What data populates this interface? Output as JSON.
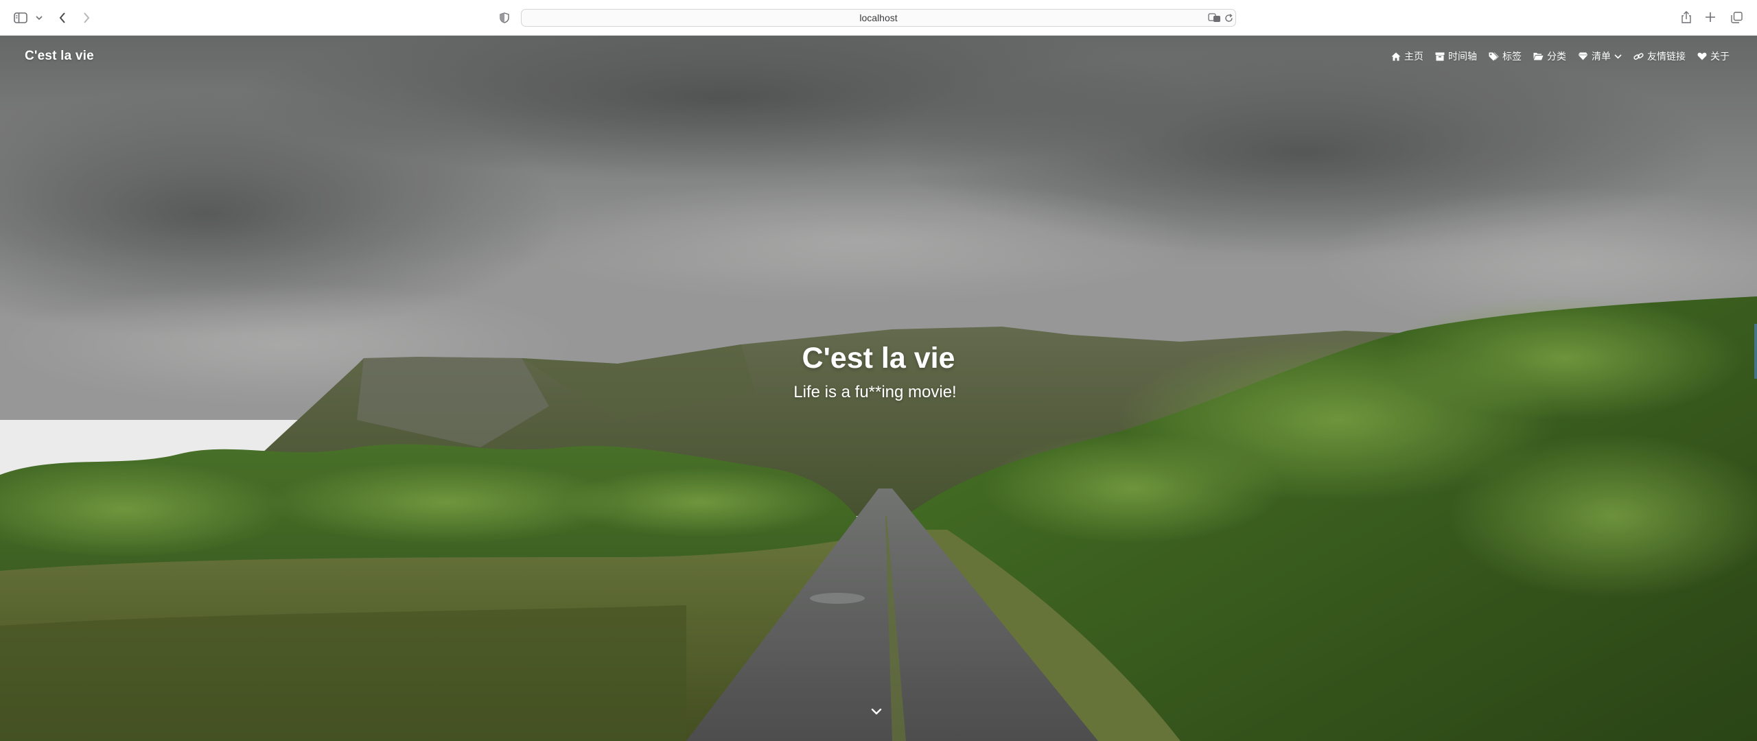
{
  "browser": {
    "url": "localhost",
    "icons": [
      "sidebar-icon",
      "chevron-down-icon",
      "back-icon",
      "forward-icon",
      "shield-icon",
      "translate-icon",
      "reload-icon",
      "share-icon",
      "new-tab-icon",
      "tabs-overview-icon"
    ]
  },
  "site": {
    "brand": "C'est la vie",
    "nav": [
      {
        "label": "主页",
        "icon": "home-icon"
      },
      {
        "label": "时间轴",
        "icon": "archive-icon"
      },
      {
        "label": "标签",
        "icon": "tags-icon"
      },
      {
        "label": "分类",
        "icon": "folder-icon"
      },
      {
        "label": "清单",
        "icon": "diamond-icon"
      },
      {
        "label": "友情链接",
        "icon": "link-icon"
      },
      {
        "label": "关于",
        "icon": "heart-icon"
      }
    ]
  },
  "hero": {
    "title": "C'est la vie",
    "subtitle": "Life is a fu**ing movie!",
    "scroll_icon": "chevron-down-icon"
  },
  "colors": {
    "text": "#ffffff",
    "sky": "#8f9090",
    "grass": "#4f7a2c",
    "road": "#6b6b6b"
  }
}
